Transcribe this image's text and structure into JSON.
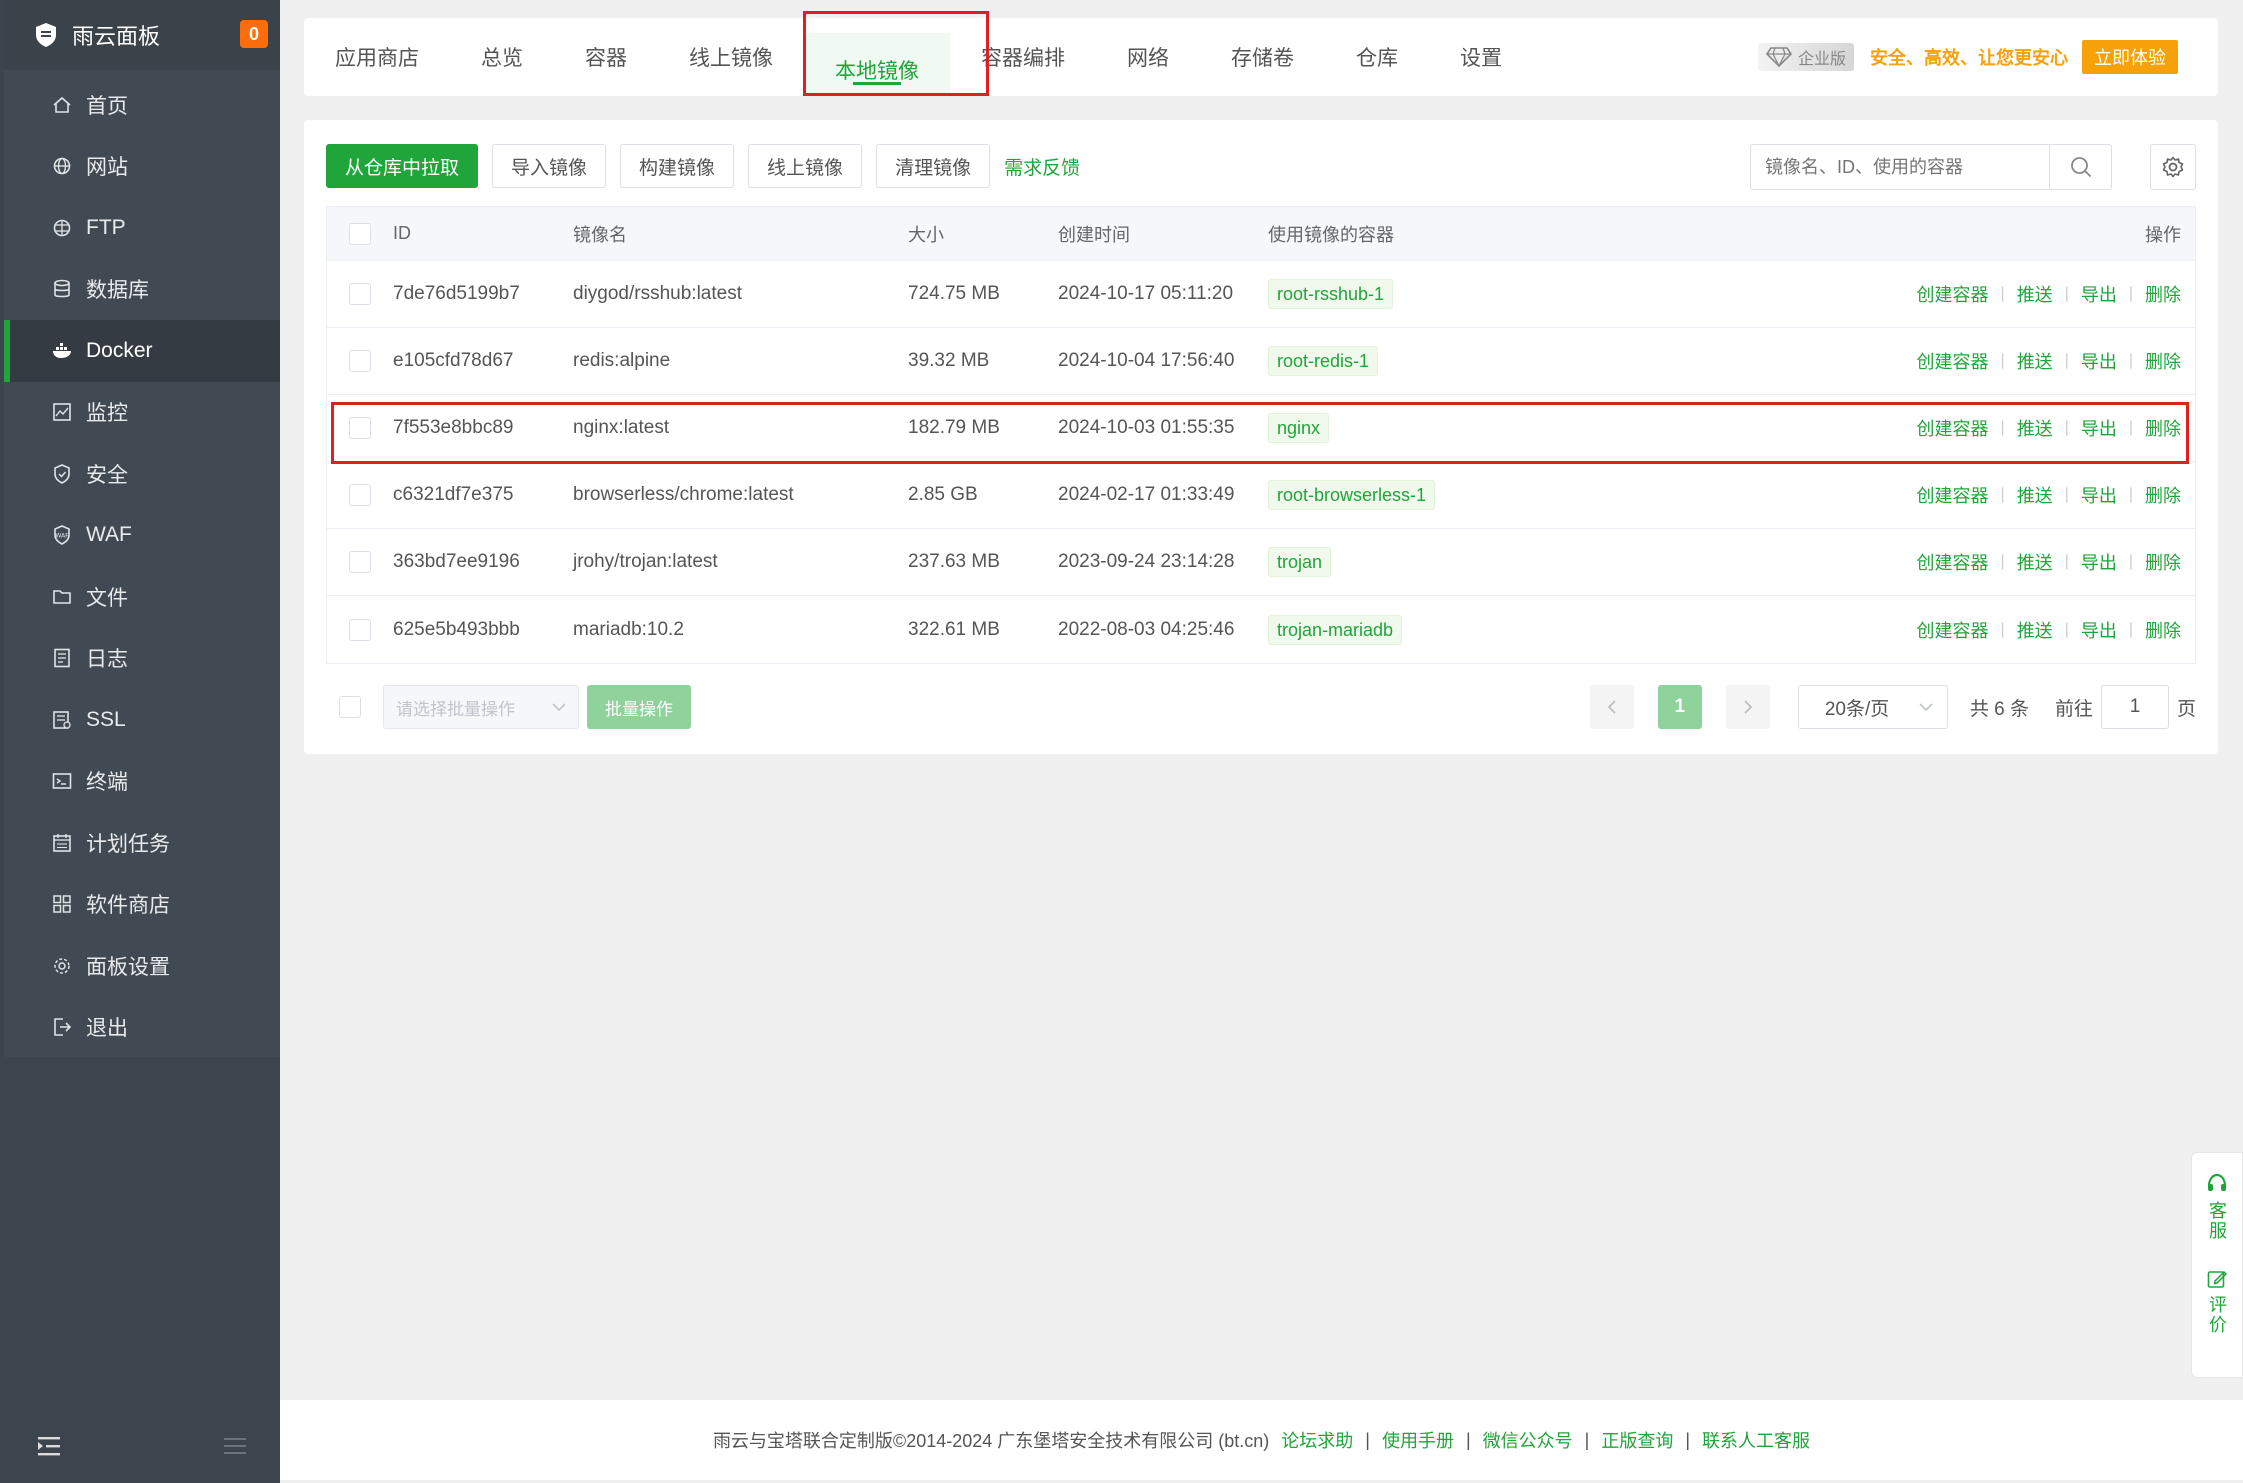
{
  "brand": {
    "title": "雨云面板",
    "badge": "0"
  },
  "sidebar": {
    "items": [
      {
        "label": "首页",
        "icon": "home-icon"
      },
      {
        "label": "网站",
        "icon": "globe-icon"
      },
      {
        "label": "FTP",
        "icon": "ftp-icon"
      },
      {
        "label": "数据库",
        "icon": "database-icon"
      },
      {
        "label": "Docker",
        "icon": "docker-icon",
        "active": true
      },
      {
        "label": "监控",
        "icon": "monitor-icon"
      },
      {
        "label": "安全",
        "icon": "shield-icon"
      },
      {
        "label": "WAF",
        "icon": "waf-icon"
      },
      {
        "label": "文件",
        "icon": "folder-icon"
      },
      {
        "label": "日志",
        "icon": "log-icon"
      },
      {
        "label": "SSL",
        "icon": "ssl-icon"
      },
      {
        "label": "终端",
        "icon": "terminal-icon"
      },
      {
        "label": "计划任务",
        "icon": "calendar-icon"
      },
      {
        "label": "软件商店",
        "icon": "apps-icon"
      },
      {
        "label": "面板设置",
        "icon": "gear-icon"
      },
      {
        "label": "退出",
        "icon": "logout-icon"
      }
    ]
  },
  "tabs": [
    "应用商店",
    "总览",
    "容器",
    "线上镜像",
    "本地镜像",
    "容器编排",
    "网络",
    "存储卷",
    "仓库",
    "设置"
  ],
  "active_tab": "本地镜像",
  "promo": {
    "edition": "企业版",
    "slogan": "安全、高效、让您更安心",
    "cta": "立即体验"
  },
  "toolbar": {
    "pull": "从仓库中拉取",
    "import": "导入镜像",
    "build": "构建镜像",
    "online": "线上镜像",
    "clean": "清理镜像",
    "feedback": "需求反馈",
    "search_placeholder": "镜像名、ID、使用的容器"
  },
  "table": {
    "headers": {
      "id": "ID",
      "name": "镜像名",
      "size": "大小",
      "created": "创建时间",
      "used_by": "使用镜像的容器",
      "ops": "操作"
    },
    "ops": [
      "创建容器",
      "推送",
      "导出",
      "删除"
    ],
    "rows": [
      {
        "id": "7de76d5199b7",
        "name": "diygod/rsshub:latest",
        "size": "724.75 MB",
        "created": "2024-10-17 05:11:20",
        "used_by": "root-rsshub-1"
      },
      {
        "id": "e105cfd78d67",
        "name": "redis:alpine",
        "size": "39.32 MB",
        "created": "2024-10-04 17:56:40",
        "used_by": "root-redis-1"
      },
      {
        "id": "7f553e8bbc89",
        "name": "nginx:latest",
        "size": "182.79 MB",
        "created": "2024-10-03 01:55:35",
        "used_by": "nginx"
      },
      {
        "id": "c6321df7e375",
        "name": "browserless/chrome:latest",
        "size": "2.85 GB",
        "created": "2024-02-17 01:33:49",
        "used_by": "root-browserless-1"
      },
      {
        "id": "363bd7ee9196",
        "name": "jrohy/trojan:latest",
        "size": "237.63 MB",
        "created": "2023-09-24 23:14:28",
        "used_by": "trojan"
      },
      {
        "id": "625e5b493bbb",
        "name": "mariadb:10.2",
        "size": "322.61 MB",
        "created": "2022-08-03 04:25:46",
        "used_by": "trojan-mariadb"
      }
    ]
  },
  "batch": {
    "placeholder": "请选择批量操作",
    "button": "批量操作"
  },
  "pager": {
    "current": "1",
    "page_size": "20条/页",
    "total": "共 6 条",
    "goto_label": "前往",
    "goto_value": "1",
    "page_suffix": "页"
  },
  "footer": {
    "copyright": "雨云与宝塔联合定制版©2014-2024 广东堡塔安全技术有限公司 (bt.cn)",
    "links": [
      "论坛求助",
      "使用手册",
      "微信公众号",
      "正版查询",
      "联系人工客服"
    ]
  },
  "float_service": {
    "service": "客服",
    "review": "评价"
  },
  "colors": {
    "accent": "#20a53a",
    "sidebar": "#414a53",
    "promo": "#f7a10a",
    "highlight": "#e02020"
  }
}
